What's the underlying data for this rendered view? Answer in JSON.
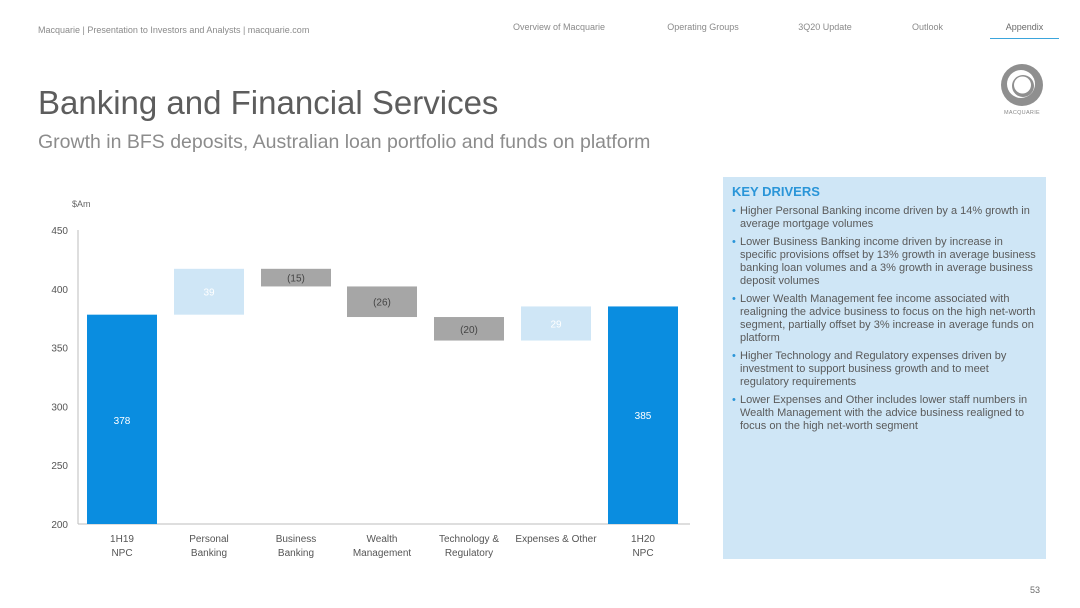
{
  "header": {
    "left_text": "Macquarie  |  Presentation to Investors and Analysts |  macquarie.com",
    "nav": [
      {
        "label": "Overview of Macquarie",
        "active": false
      },
      {
        "label": "Operating Groups",
        "active": false
      },
      {
        "label": "3Q20 Update",
        "active": false
      },
      {
        "label": "Outlook",
        "active": false
      },
      {
        "label": "Appendix",
        "active": true
      }
    ]
  },
  "logo": {
    "text": "MACQUARIE",
    "icon": "macquarie-logo-icon"
  },
  "title": "Banking and Financial Services",
  "subtitle": "Growth in BFS deposits, Australian loan portfolio and funds on platform",
  "colors": {
    "total": "#0a8de0",
    "increase": "#cfe6f6",
    "decrease": "#a6a6a6",
    "accent": "#2a95d8"
  },
  "chart_data": {
    "type": "bar",
    "subtype": "waterfall",
    "ylabel": "$Am",
    "ylim": [
      200,
      450
    ],
    "yticks": [
      200,
      250,
      300,
      350,
      400,
      450
    ],
    "categories": [
      [
        "1H19",
        "NPC"
      ],
      [
        "Personal",
        "Banking"
      ],
      [
        "Business",
        "Banking"
      ],
      [
        "Wealth",
        "Management"
      ],
      [
        "Technology &",
        "Regulatory"
      ],
      [
        "Expenses & Other"
      ],
      [
        "1H20",
        "NPC"
      ]
    ],
    "values": [
      378,
      39,
      -15,
      -26,
      -20,
      29,
      385
    ],
    "kinds": [
      "total",
      "increase",
      "decrease",
      "decrease",
      "decrease",
      "increase",
      "total"
    ],
    "labels": [
      "378",
      "39",
      "(15)",
      "(26)",
      "(20)",
      "29",
      "385"
    ]
  },
  "key_drivers": {
    "title": "KEY DRIVERS",
    "items": [
      "Higher Personal Banking income driven by a 14% growth in average mortgage volumes",
      "Lower Business Banking income driven by increase in specific provisions offset by 13% growth in average business banking loan volumes and a 3% growth in average business deposit volumes",
      "Lower Wealth Management fee income associated with realigning the advice business to focus on the high net-worth segment, partially offset by 3% increase in average funds on platform",
      "Higher Technology and Regulatory expenses driven by investment to support business growth and to meet regulatory requirements",
      "Lower Expenses and Other includes lower staff numbers in Wealth Management with the advice business realigned to focus on the high net-worth segment"
    ]
  },
  "page_number": "53"
}
